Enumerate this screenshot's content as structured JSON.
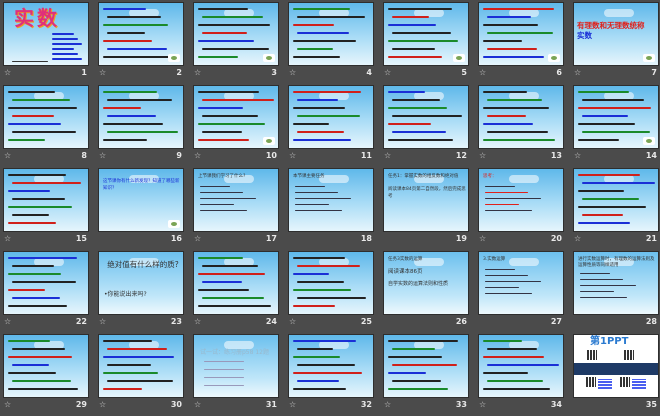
{
  "slides": [
    {
      "n": "1",
      "title": "实数",
      "star": true,
      "kind": "title"
    },
    {
      "n": "2",
      "star": true
    },
    {
      "n": "3",
      "star": true
    },
    {
      "n": "4",
      "star": true
    },
    {
      "n": "5",
      "star": true
    },
    {
      "n": "6",
      "star": true
    },
    {
      "n": "7",
      "star": true,
      "kind": "big",
      "title": "有理数和无理数统称",
      "title2": "实数"
    },
    {
      "n": "8",
      "star": true
    },
    {
      "n": "9",
      "star": true
    },
    {
      "n": "10",
      "star": true
    },
    {
      "n": "11",
      "star": true
    },
    {
      "n": "12",
      "star": true
    },
    {
      "n": "13",
      "star": true
    },
    {
      "n": "14",
      "star": true
    },
    {
      "n": "15",
      "star": true
    },
    {
      "n": "16",
      "star": false,
      "kind": "text",
      "body": "这节课你有什么新发现？知道了哪些新知识？"
    },
    {
      "n": "17",
      "star": true,
      "kind": "text",
      "heading": "上节课我们学习了什么?"
    },
    {
      "n": "18",
      "star": false,
      "kind": "text",
      "heading": "本节课主要任务"
    },
    {
      "n": "19",
      "star": false,
      "kind": "text",
      "heading": "任务1：掌握实数的相反数和绝对值",
      "body": "阅读课本84页第二自然段，然后完成思考"
    },
    {
      "n": "20",
      "star": true,
      "kind": "text",
      "heading": "思考："
    },
    {
      "n": "21",
      "star": true
    },
    {
      "n": "22",
      "star": true
    },
    {
      "n": "23",
      "star": true,
      "kind": "plainbig",
      "title": "绝对值有什么样的质?",
      "bullet": "•你能说出来吗?"
    },
    {
      "n": "24",
      "star": true
    },
    {
      "n": "25",
      "star": true
    },
    {
      "n": "26",
      "star": false,
      "kind": "plaintext",
      "heading": "任务3实数的运算",
      "body": "阅读课本86页",
      "body2": "自学实数的运算法则和性质"
    },
    {
      "n": "27",
      "star": false,
      "kind": "plaintext",
      "heading": "3.实数运算"
    },
    {
      "n": "28",
      "star": false,
      "kind": "plaintext",
      "heading": "进行实数运算时，有理数的运算法则及运算性质等同样适用"
    },
    {
      "n": "29",
      "star": true
    },
    {
      "n": "30",
      "star": true
    },
    {
      "n": "31",
      "star": true,
      "kind": "plainbig2",
      "title": "试一试：练习册p58 12题"
    },
    {
      "n": "32",
      "star": true
    },
    {
      "n": "33",
      "star": true
    },
    {
      "n": "34",
      "star": true
    },
    {
      "n": "35",
      "star": false,
      "kind": "ppt",
      "title": "第1PPT"
    }
  ],
  "colors": {
    "background": "#4b4b4b",
    "sky": "#5fb8ea",
    "red": "#e0201a",
    "blue": "#1a2fd6"
  }
}
